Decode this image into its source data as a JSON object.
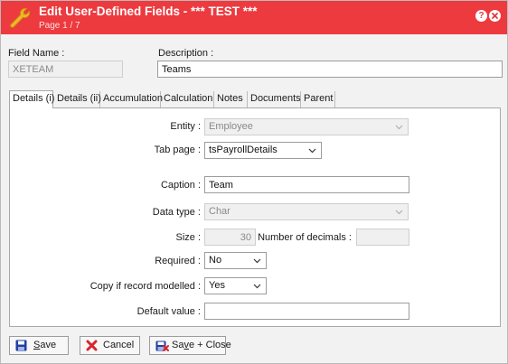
{
  "window": {
    "title": "Edit User-Defined Fields - *** TEST ***",
    "page_indicator": "Page 1 / 7",
    "help_glyph": "?"
  },
  "header": {
    "field_name_label": "Field Name :",
    "field_name_value": "XETEAM",
    "description_label": "Description :",
    "description_value": "Teams"
  },
  "tabs": [
    {
      "label": "Details (i)",
      "active": true
    },
    {
      "label": "Details (ii)"
    },
    {
      "label": "Accumulation"
    },
    {
      "label": "Calculation"
    },
    {
      "label": "Notes"
    },
    {
      "label": "Documents"
    },
    {
      "label": "Parent"
    }
  ],
  "form": {
    "entity_label": "Entity :",
    "entity_value": "Employee",
    "tab_page_label": "Tab page :",
    "tab_page_value": "tsPayrollDetails",
    "caption_label": "Caption :",
    "caption_value": "Team",
    "data_type_label": "Data type :",
    "data_type_value": "Char",
    "size_label": "Size :",
    "size_value": "30",
    "decimals_label": "Number of decimals :",
    "decimals_value": "",
    "required_label": "Required :",
    "required_value": "No",
    "copy_label": "Copy if record modelled :",
    "copy_value": "Yes",
    "default_label": "Default value :",
    "default_value": ""
  },
  "footer": {
    "save_pre": "",
    "save_key": "S",
    "save_post": "ave",
    "cancel_label": "Cancel",
    "save_close_pre": "Sa",
    "save_close_key": "v",
    "save_close_post": "e + Close"
  },
  "colors": {
    "titlebar": "#ec3a3f",
    "save_icon": "#1f3fa3",
    "cancel_icon": "#d9252b"
  },
  "icons": {
    "title": "wrench-icon",
    "help": "help-icon",
    "close": "close-icon",
    "save": "floppy-disk-icon",
    "cancel": "cancel-x-icon",
    "save_close": "floppy-disk-close-icon"
  }
}
